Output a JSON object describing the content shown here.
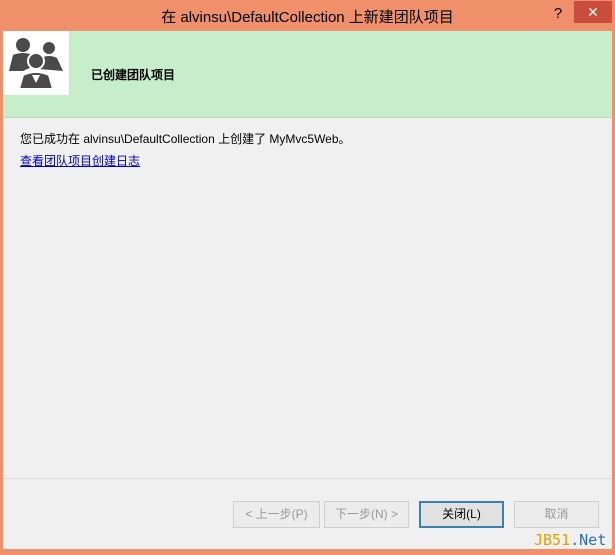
{
  "window": {
    "title": "在 alvinsu\\DefaultCollection 上新建团队项目",
    "help_label": "?",
    "close_label": "✕"
  },
  "banner": {
    "icon": "team-icon",
    "title": "已创建团队项目"
  },
  "content": {
    "message": "您已成功在 alvinsu\\DefaultCollection 上创建了 MyMvc5Web。",
    "log_link": "查看团队项目创建日志"
  },
  "buttons": {
    "prev_label": "< 上一步(P)",
    "next_label": "下一步(N) >",
    "close_label": "关闭(L)",
    "cancel_label": "取消"
  },
  "watermark": {
    "part_a": "JB51",
    "part_b": ".Net"
  },
  "colors": {
    "titlebar": "#f0906a",
    "banner": "#c7eecb",
    "link": "#0000cc",
    "close_button": "#c94c3c"
  }
}
